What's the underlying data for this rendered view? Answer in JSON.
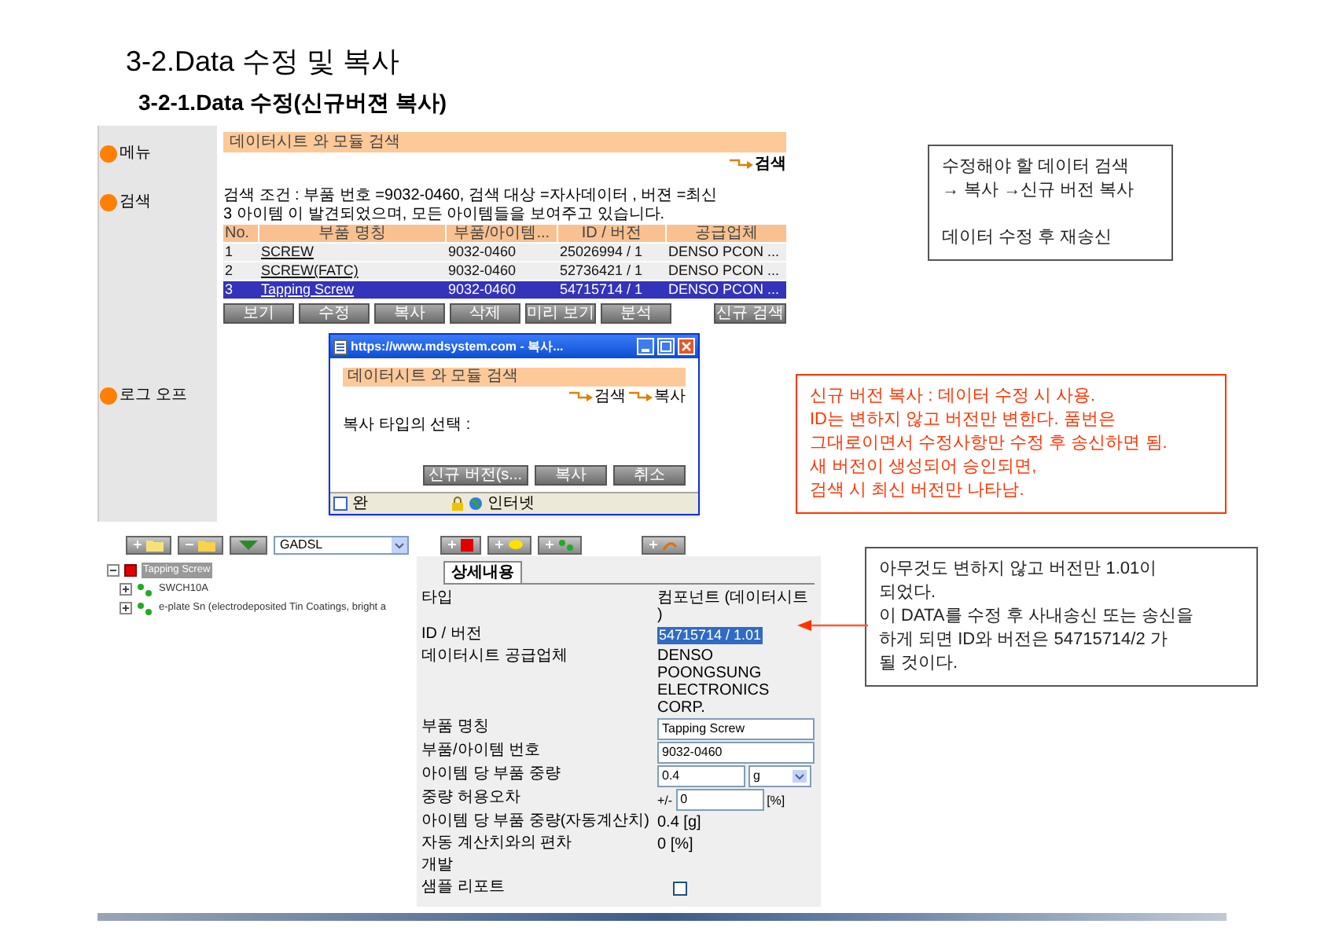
{
  "title": "3-2.Data 수정 및 복사",
  "subtitle": "3-2-1.Data 수정(신규버젼 복사)",
  "search_screen": {
    "sidebar": {
      "items": [
        {
          "label": "메뉴"
        },
        {
          "label": "검색"
        }
      ],
      "bottom_items": [
        {
          "label": "로그 오프"
        }
      ]
    },
    "header": "데이터시트 와 모듈 검색",
    "breadcrumb": [
      "검색"
    ],
    "condition": "검색 조건 : 부품 번호 =9032-0460, 검색 대상 =자사데이터 , 버젼 =최신",
    "result": "3 아이템 이 발견되었으며, 모든 아이템들을 보여주고 있습니다.",
    "table": {
      "columns": [
        "No.",
        "부품 명칭",
        "부품/아이템...",
        "ID / 버전",
        "공급업체"
      ],
      "rows": [
        {
          "cells": [
            "1",
            "SCREW",
            "9032-0460",
            "25026994 / 1",
            "DENSO PCON ..."
          ],
          "selected": false
        },
        {
          "cells": [
            "2",
            "SCREW(FATC)",
            "9032-0460",
            "52736421 / 1",
            "DENSO PCON ..."
          ],
          "selected": false
        },
        {
          "cells": [
            "3",
            "Tapping Screw",
            "9032-0460",
            "54715714 / 1",
            "DENSO PCON ..."
          ],
          "selected": true
        }
      ]
    },
    "buttons": [
      "보기",
      "수정",
      "복사",
      "삭제",
      "미리 보기",
      "분석"
    ],
    "new_search_button": "신규 검색"
  },
  "copy_dialog": {
    "title": "https://www.mdsystem.com - 복사...",
    "header": "데이터시트 와 모듈 검색",
    "breadcrumb": [
      "검색",
      "복사"
    ],
    "prompt": "복사 타입의 선택 :",
    "buttons": [
      "신규 버전(s...",
      "복사",
      "취소"
    ],
    "status": "완",
    "zone": "인터넷"
  },
  "detail_screen": {
    "dropdown": {
      "value": "GADSL"
    },
    "tree": [
      {
        "label": "Tapping Screw",
        "kind": "component",
        "expanded": true,
        "selected": true,
        "children": [
          {
            "label": "SWCH10A",
            "kind": "material",
            "expanded": false,
            "selected": false
          },
          {
            "label": "e-plate Sn (electrodeposited Tin Coatings, bright a",
            "kind": "material",
            "expanded": false,
            "selected": false
          }
        ]
      }
    ],
    "tabs": [
      {
        "label": "상세내용",
        "selected": true
      }
    ],
    "fields": [
      {
        "kind": "text",
        "label": "타입",
        "value": "컴포넌트 (데이터시트 )"
      },
      {
        "kind": "selected_text",
        "label": "ID / 버전",
        "value": "54715714 / 1.01"
      },
      {
        "kind": "text",
        "label": "데이터시트 공급업체",
        "value": "DENSO POONGSUNG ELECTRONICS CORP."
      },
      {
        "kind": "input",
        "label": "부품 명칭",
        "value": "Tapping Screw"
      },
      {
        "kind": "input",
        "label": "부품/아이템 번호",
        "value": "9032-0460"
      },
      {
        "kind": "input_select",
        "label": "아이템 당 부품 중량",
        "value": "0.4",
        "unit": "g"
      },
      {
        "kind": "input_prefix",
        "label": "중량 허용오차",
        "prefix": "+/-",
        "value": "0",
        "unit": "[%]"
      },
      {
        "kind": "text",
        "label": "아이템 당 부품 중량(자동계산치)",
        "value": "0.4 [g]"
      },
      {
        "kind": "text",
        "label": "자동 계산치와의 편차",
        "value": "0 [%]"
      },
      {
        "kind": "heading",
        "label": "개발"
      },
      {
        "kind": "checkbox",
        "label": "샘플 리포트",
        "checked": false
      }
    ]
  },
  "notes": [
    {
      "kind": "plain",
      "paragraphs": [
        [
          "수정해야 할 데이터 검색",
          "→ 복사 →신규 버전 복사"
        ],
        [
          "데이터 수정 후 재송신"
        ]
      ]
    },
    {
      "kind": "warning",
      "paragraphs": [
        [
          "신규 버전 복사 : 데이터 수정 시 사용.",
          "ID는 변하지 않고 버전만 변한다. 품번은",
          "그대로이면서 수정사항만 수정 후 송신하면 됨.",
          "새 버전이 생성되어 승인되면,",
          "검색 시 최신 버전만 나타남."
        ]
      ]
    },
    {
      "kind": "plain",
      "paragraphs": [
        [
          "아무것도 변하지 않고 버전만 1.01이",
          "되었다.",
          "이 DATA를 수정 후 사내송신 또는 송신을",
          "하게 되면 ID와 버전은 54715714/2 가",
          "될 것이다."
        ]
      ]
    }
  ]
}
